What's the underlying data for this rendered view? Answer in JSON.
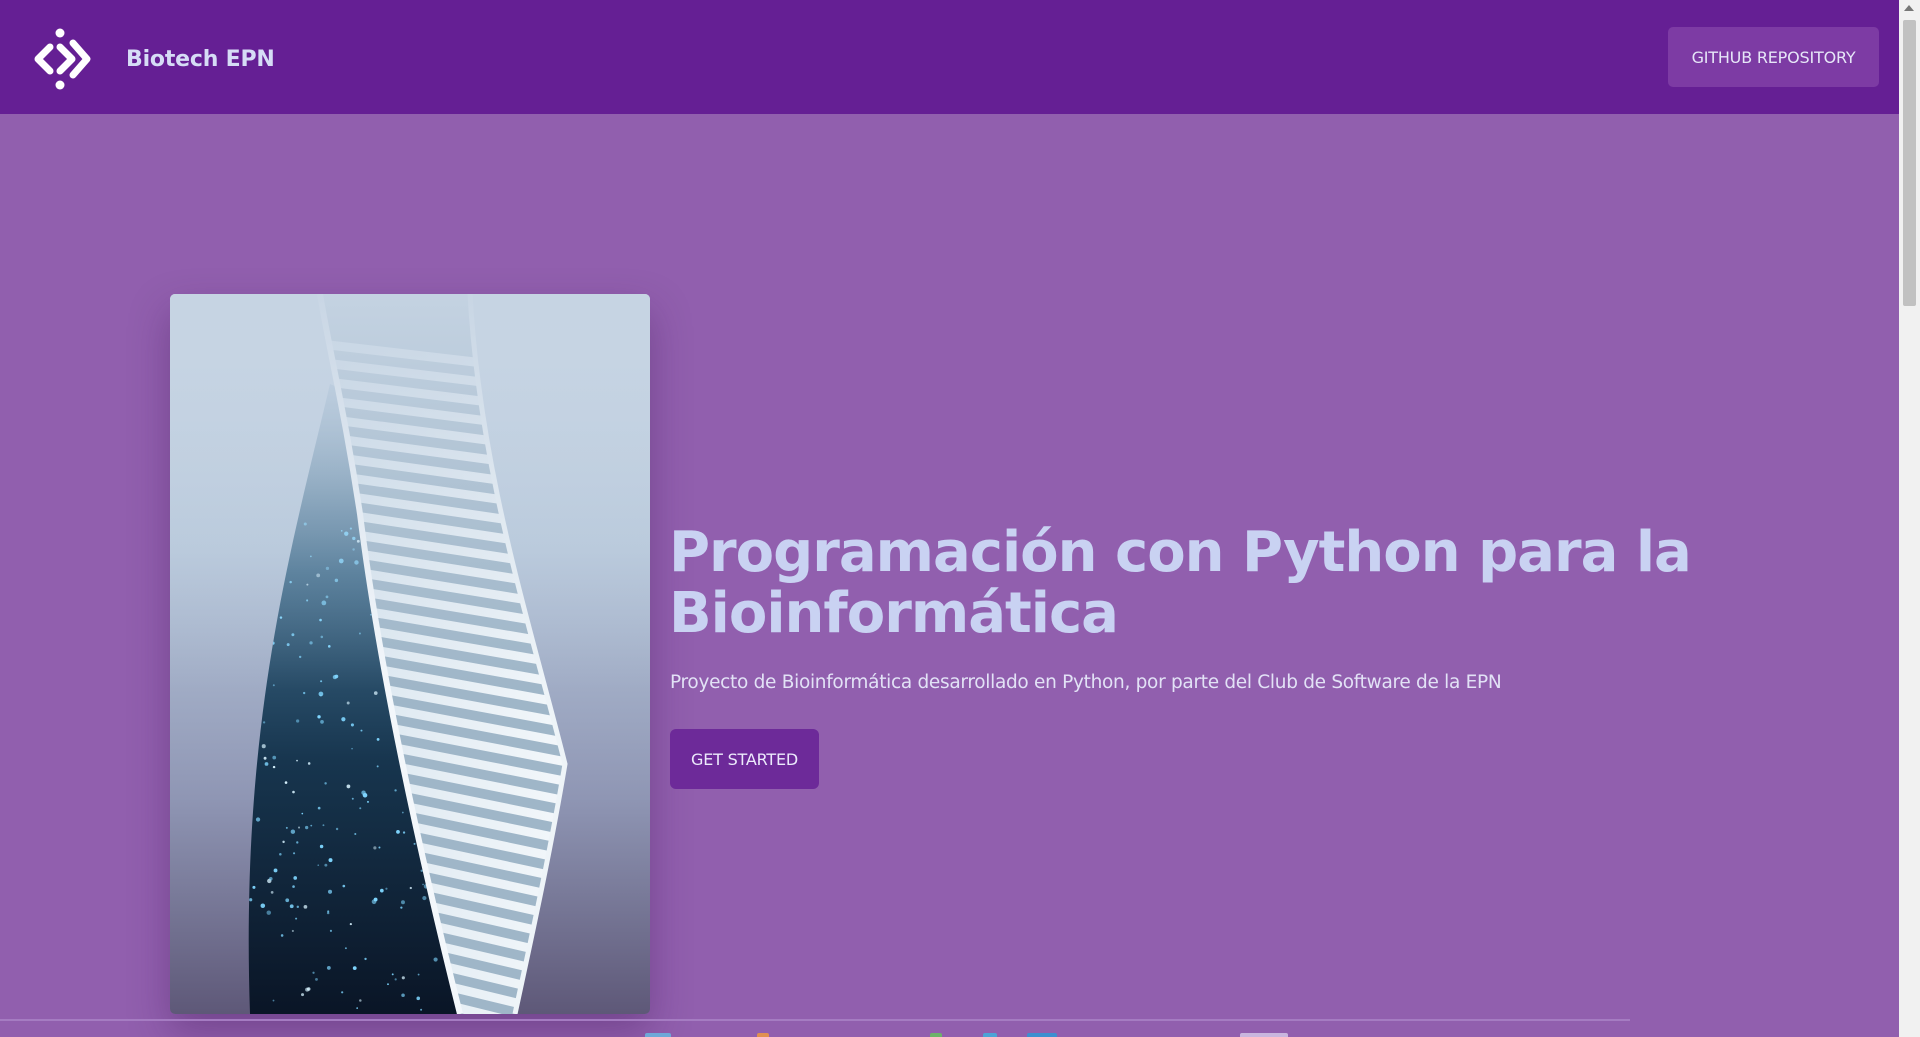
{
  "navbar": {
    "brand_name": "Biotech EPN",
    "logo_icon": "diamond-chevrons-logo-icon",
    "github_label": "GITHUB REPOSITORY"
  },
  "hero": {
    "image_icon": "spiral-skyscraper-image",
    "title": "Programación con Python para la Bioinformática",
    "subtitle": "Proyecto de Bioinformática desarrollado en Python, por parte del Club de Software de la EPN",
    "cta_label": "GET STARTED"
  },
  "colors": {
    "navbar_bg": "#651f94",
    "page_bg": "#915fae",
    "title_text": "#c9d2f2",
    "github_button_bg": "#7d3ba4",
    "cta_button_bg": "#6d2a99"
  }
}
